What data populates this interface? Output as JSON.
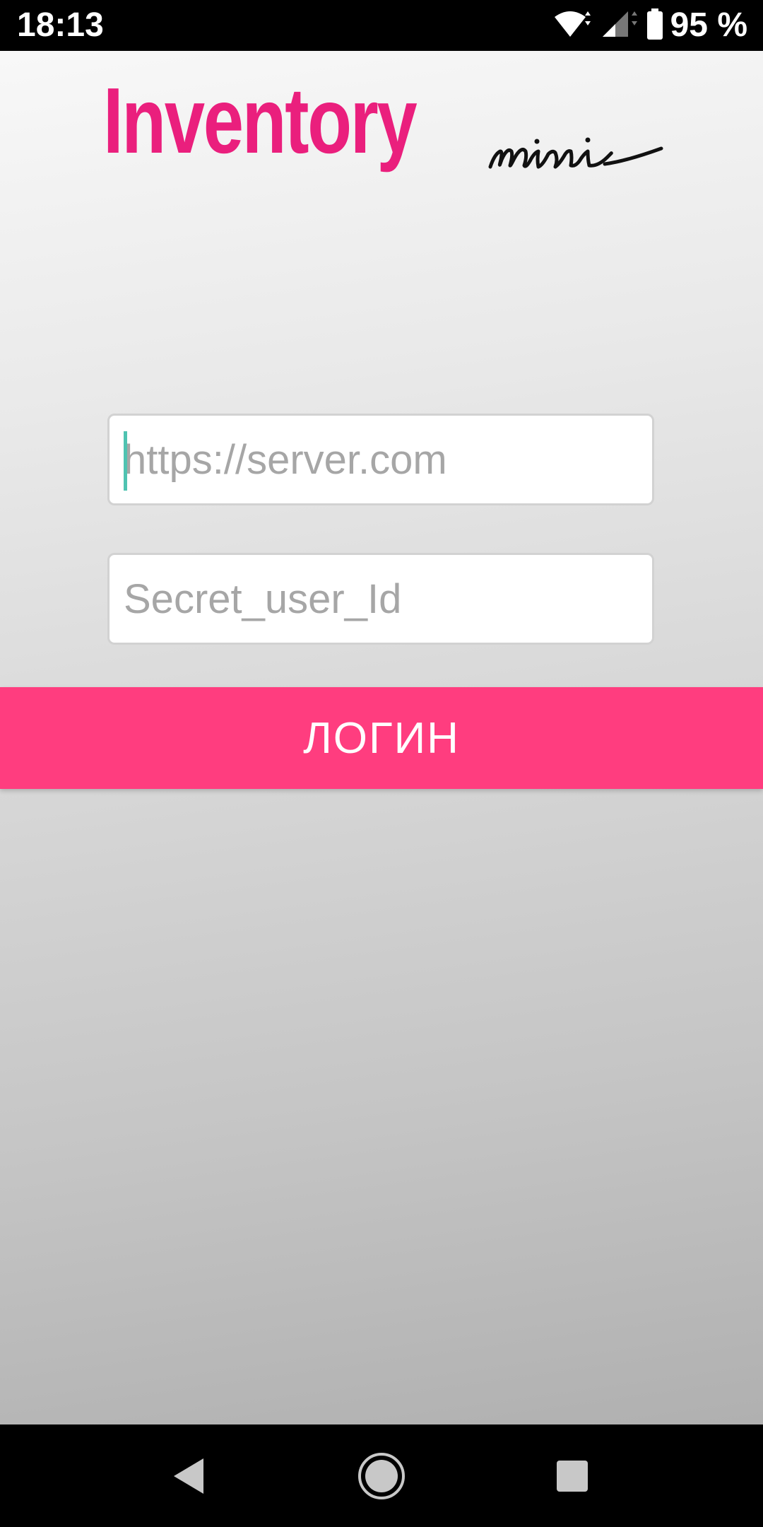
{
  "status_bar": {
    "time": "18:13",
    "battery_text": "95 %",
    "icons": [
      "wifi-icon",
      "cell-signal-icon",
      "battery-icon"
    ]
  },
  "app": {
    "logo": {
      "main": "Inventory",
      "sub": "mini"
    },
    "server_field": {
      "placeholder": "https://server.com",
      "value": ""
    },
    "user_field": {
      "placeholder": "Secret_user_Id",
      "value": ""
    },
    "login_button_label": "ЛОГИН"
  },
  "nav_bar": {
    "buttons": [
      "back-icon",
      "home-icon",
      "recents-icon"
    ]
  },
  "colors": {
    "brand_pink": "#ea1f7d",
    "button_pink": "#ff3d7f",
    "caret": "#4fc3b1"
  }
}
